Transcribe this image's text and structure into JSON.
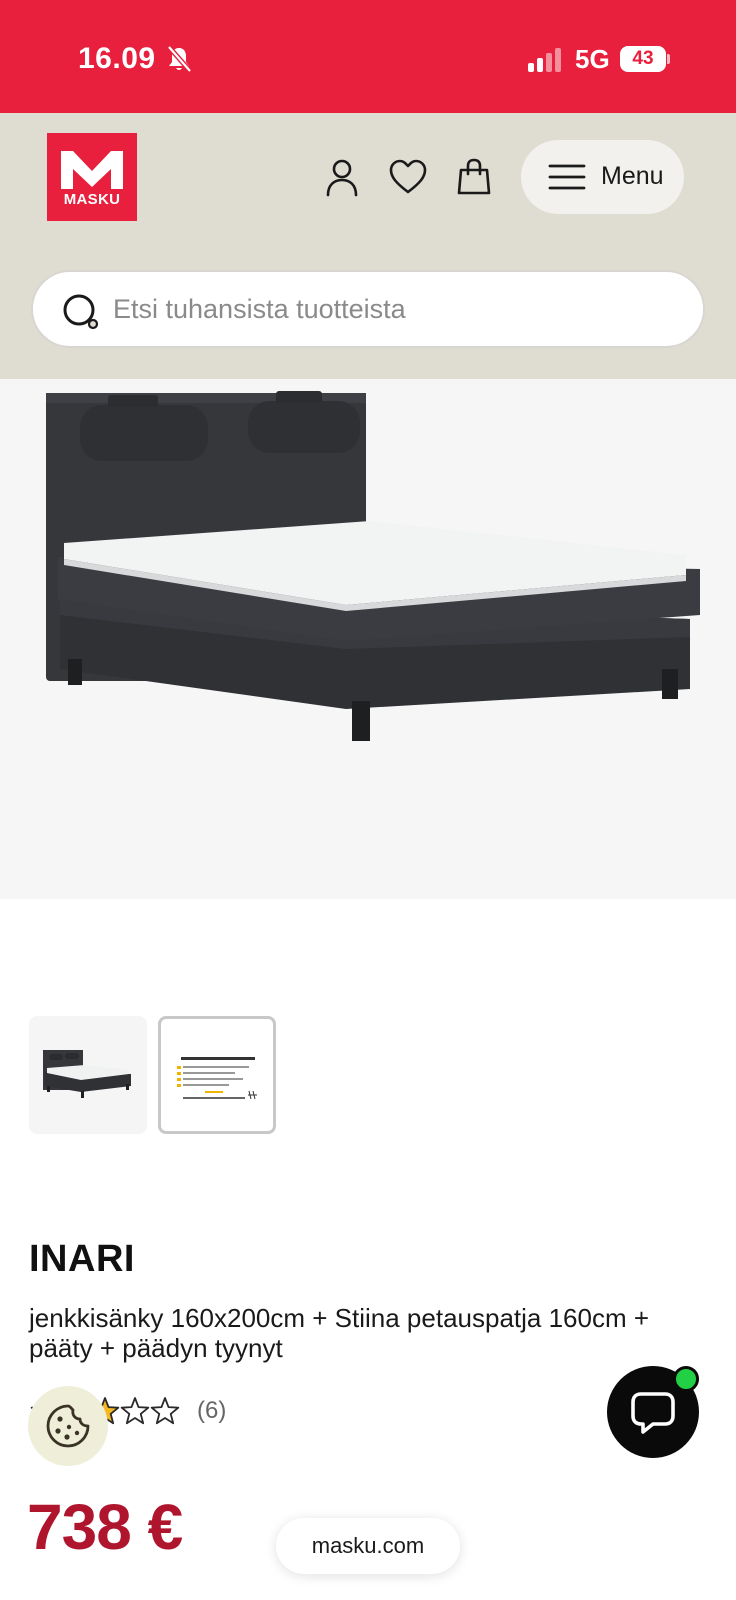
{
  "status_bar": {
    "time": "16.09",
    "network": "5G",
    "battery": "43"
  },
  "header": {
    "logo_text": "MASKU",
    "menu_label": "Menu",
    "icons": [
      "user-icon",
      "heart-icon",
      "bag-icon",
      "hamburger-icon"
    ]
  },
  "search": {
    "placeholder": "Etsi tuhansista tuotteista"
  },
  "product": {
    "brand": "INARI",
    "description": "jenkkisänky 160x200cm + Stiina petauspatja 160cm + pääty + päädyn tyynyt",
    "rating": 3,
    "rating_max": 5,
    "review_count": "(6)",
    "price": "738 €"
  },
  "gallery": {
    "thumbnails": [
      "bed-photo",
      "info-card"
    ],
    "info_card": {
      "title": "Miksi tyytyväisyys Maskuun on yli 90%?",
      "lines": [
        "98% tuotteista edullisimmin kuin muualla",
        "Kotiinkuljetus ja asennus",
        "Suomen suurin sohva- ja sänkyvalikoima",
        "Jopa 5 vk kuukausimaksu"
      ],
      "footer": "14000 arvostelun keskiarvo 4,3/5"
    }
  },
  "browser": {
    "url": "masku.com"
  },
  "colors": {
    "brand_red": "#e8203d",
    "header_bg": "#dfdcd2",
    "price_red": "#b0152e",
    "chat_online": "#22d046"
  }
}
